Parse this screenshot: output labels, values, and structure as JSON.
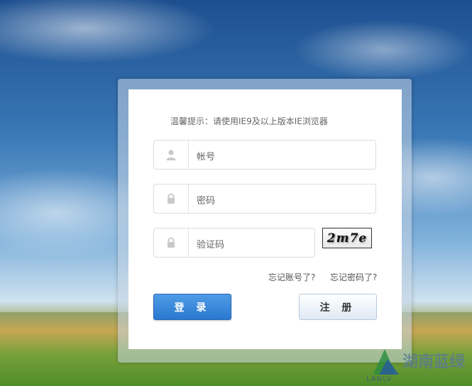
{
  "notice": "温馨提示：请使用IE9及以上版本IE浏览器",
  "form": {
    "account_placeholder": "帐号",
    "password_placeholder": "密码",
    "captcha_placeholder": "验证码",
    "captcha_text": "2m7e",
    "forgot_account": "忘记账号了?",
    "forgot_password": "忘记密码了?",
    "login_label": "登 录",
    "register_label": "注 册"
  },
  "logo": {
    "name": "湖南蓝绿",
    "sub": "LANLV"
  },
  "icons": {
    "account": "user-icon",
    "password": "lock-icon",
    "captcha": "lock-icon"
  },
  "colors": {
    "login_button": "#2a79d0",
    "register_button": "#dfe9f4"
  }
}
